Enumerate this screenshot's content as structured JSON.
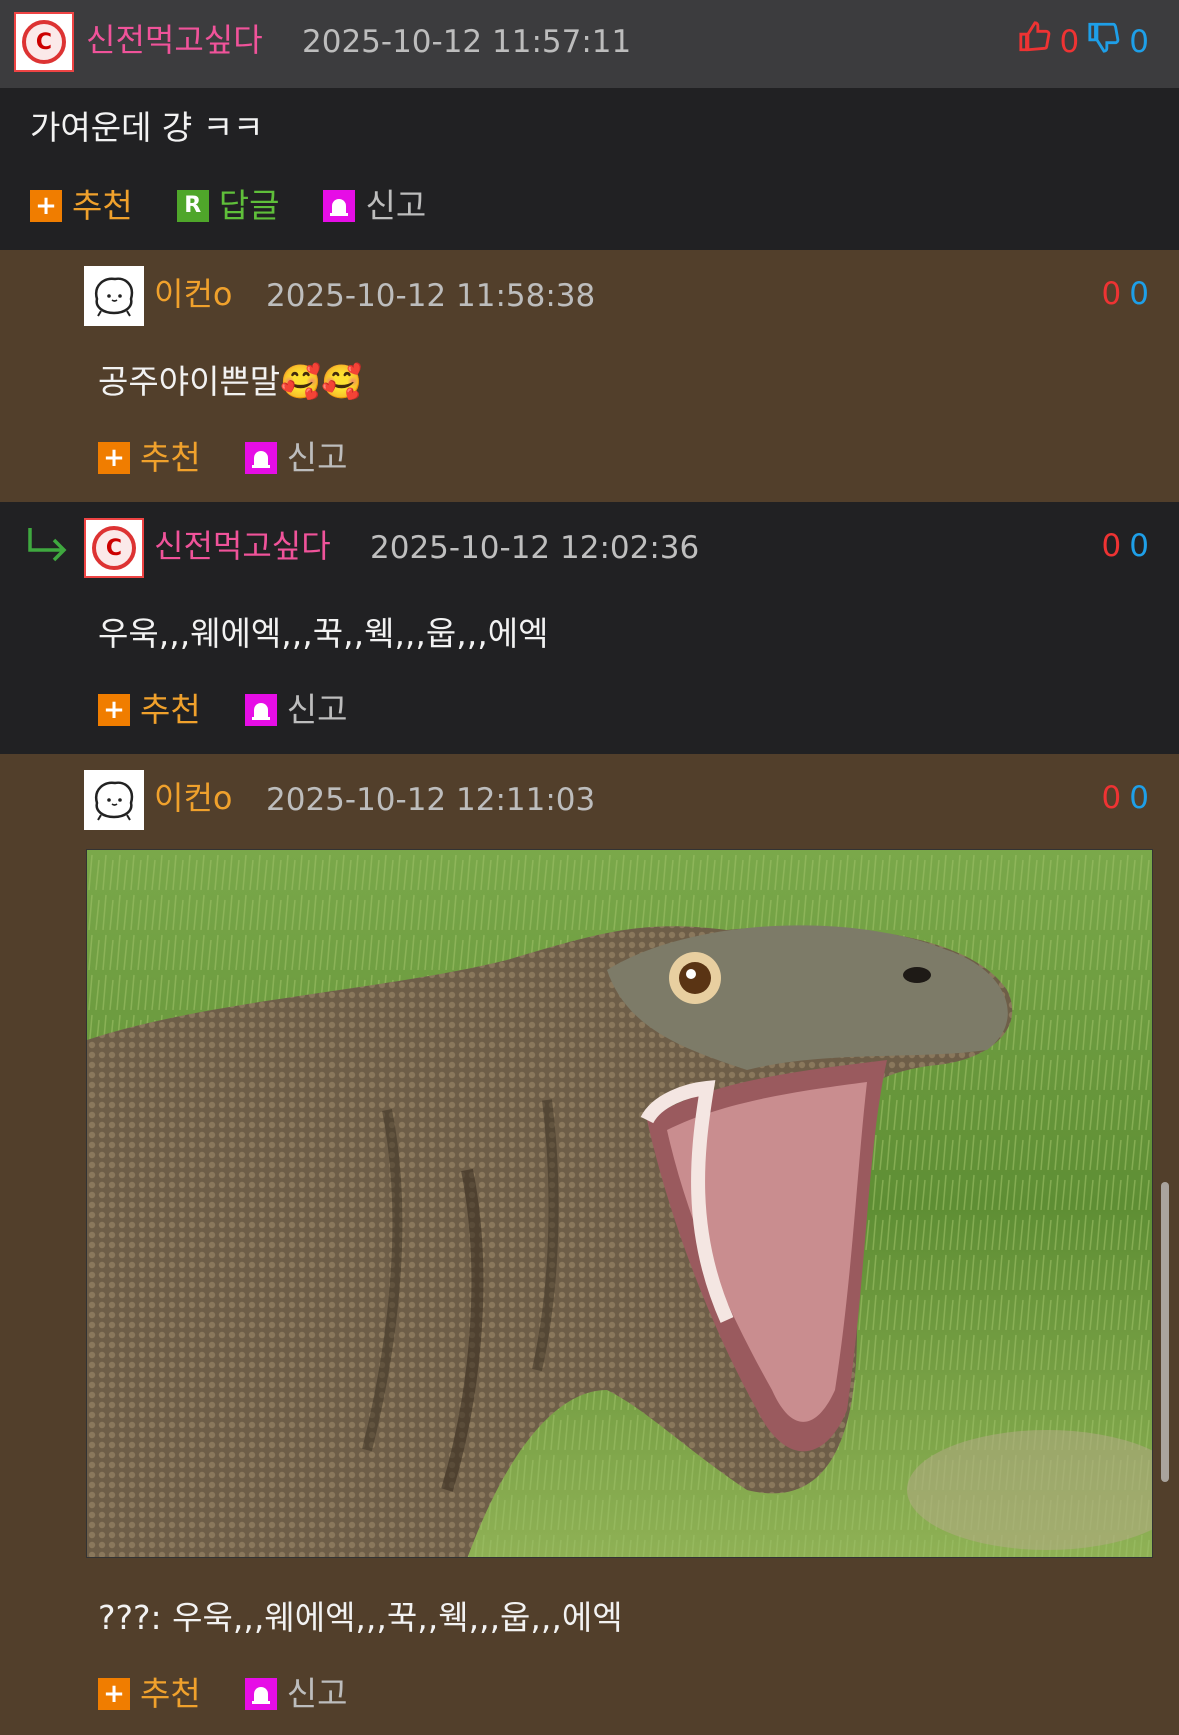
{
  "comments": [
    {
      "nickname": "신전먹고싶다",
      "timestamp": "2025-10-12 11:57:11",
      "up": "0",
      "down": "0",
      "text": "가여운데 걍 ㅋㅋ",
      "actions": {
        "recommend": "추천",
        "reply": "답글",
        "report": "신고"
      }
    },
    {
      "nickname": "이컨o",
      "timestamp": "2025-10-12 11:58:38",
      "up": "0",
      "down": "0",
      "text": "공주야이쁜말🥰🥰",
      "actions": {
        "recommend": "추천",
        "report": "신고"
      }
    },
    {
      "nickname": "신전먹고싶다",
      "timestamp": "2025-10-12 12:02:36",
      "up": "0",
      "down": "0",
      "text": "우욱,,,웨에엑,,,꾹,,웩,,,웁,,,에엑",
      "actions": {
        "recommend": "추천",
        "report": "신고"
      }
    },
    {
      "nickname": "이컨o",
      "timestamp": "2025-10-12 12:11:03",
      "up": "0",
      "down": "0",
      "text": "???: 우욱,,,웨에엑,,,꾹,,웩,,,웁,,,에엑",
      "actions": {
        "recommend": "추천",
        "report": "신고"
      }
    }
  ],
  "icons": {
    "thumbs_up": "thumbs-up-icon",
    "thumbs_down": "thumbs-down-icon",
    "reply_arrow": "reply-arrow-icon",
    "plus": "plus-icon",
    "reply_r": "reply-r-icon",
    "report": "siren-icon"
  },
  "colors": {
    "pink_nick": "#f0539a",
    "orange_nick": "#f0a12c",
    "vote_up": "#e33333",
    "vote_down": "#1e9fe8",
    "brown_bg": "#523f2b",
    "dark_bg": "#212123"
  }
}
